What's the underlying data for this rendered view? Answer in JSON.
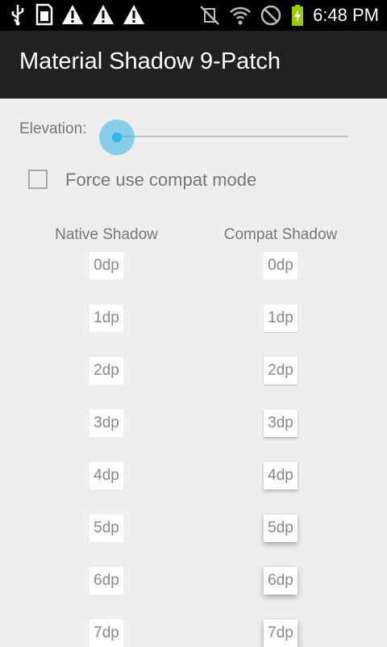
{
  "status_bar": {
    "time": "6:48 PM",
    "icons_left": [
      "usb-icon",
      "sd-card-icon",
      "warning-icon",
      "warning-icon",
      "warning-icon"
    ],
    "icons_right": [
      "vibrate-mute-icon",
      "wifi-icon",
      "no-signal-icon",
      "battery-charging-icon"
    ]
  },
  "app": {
    "title": "Material Shadow 9-Patch"
  },
  "controls": {
    "elevation_label": "Elevation:",
    "elevation_value": 0,
    "compat_checkbox_label": "Force use compat mode",
    "compat_checked": false
  },
  "columns": {
    "native_header": "Native Shadow",
    "compat_header": "Compat Shadow"
  },
  "rows": [
    "0dp",
    "1dp",
    "2dp",
    "3dp",
    "4dp",
    "5dp",
    "6dp",
    "7dp"
  ],
  "colors": {
    "accent": "#33b5e5",
    "action_bar": "#212121",
    "background": "#eeeeee"
  }
}
